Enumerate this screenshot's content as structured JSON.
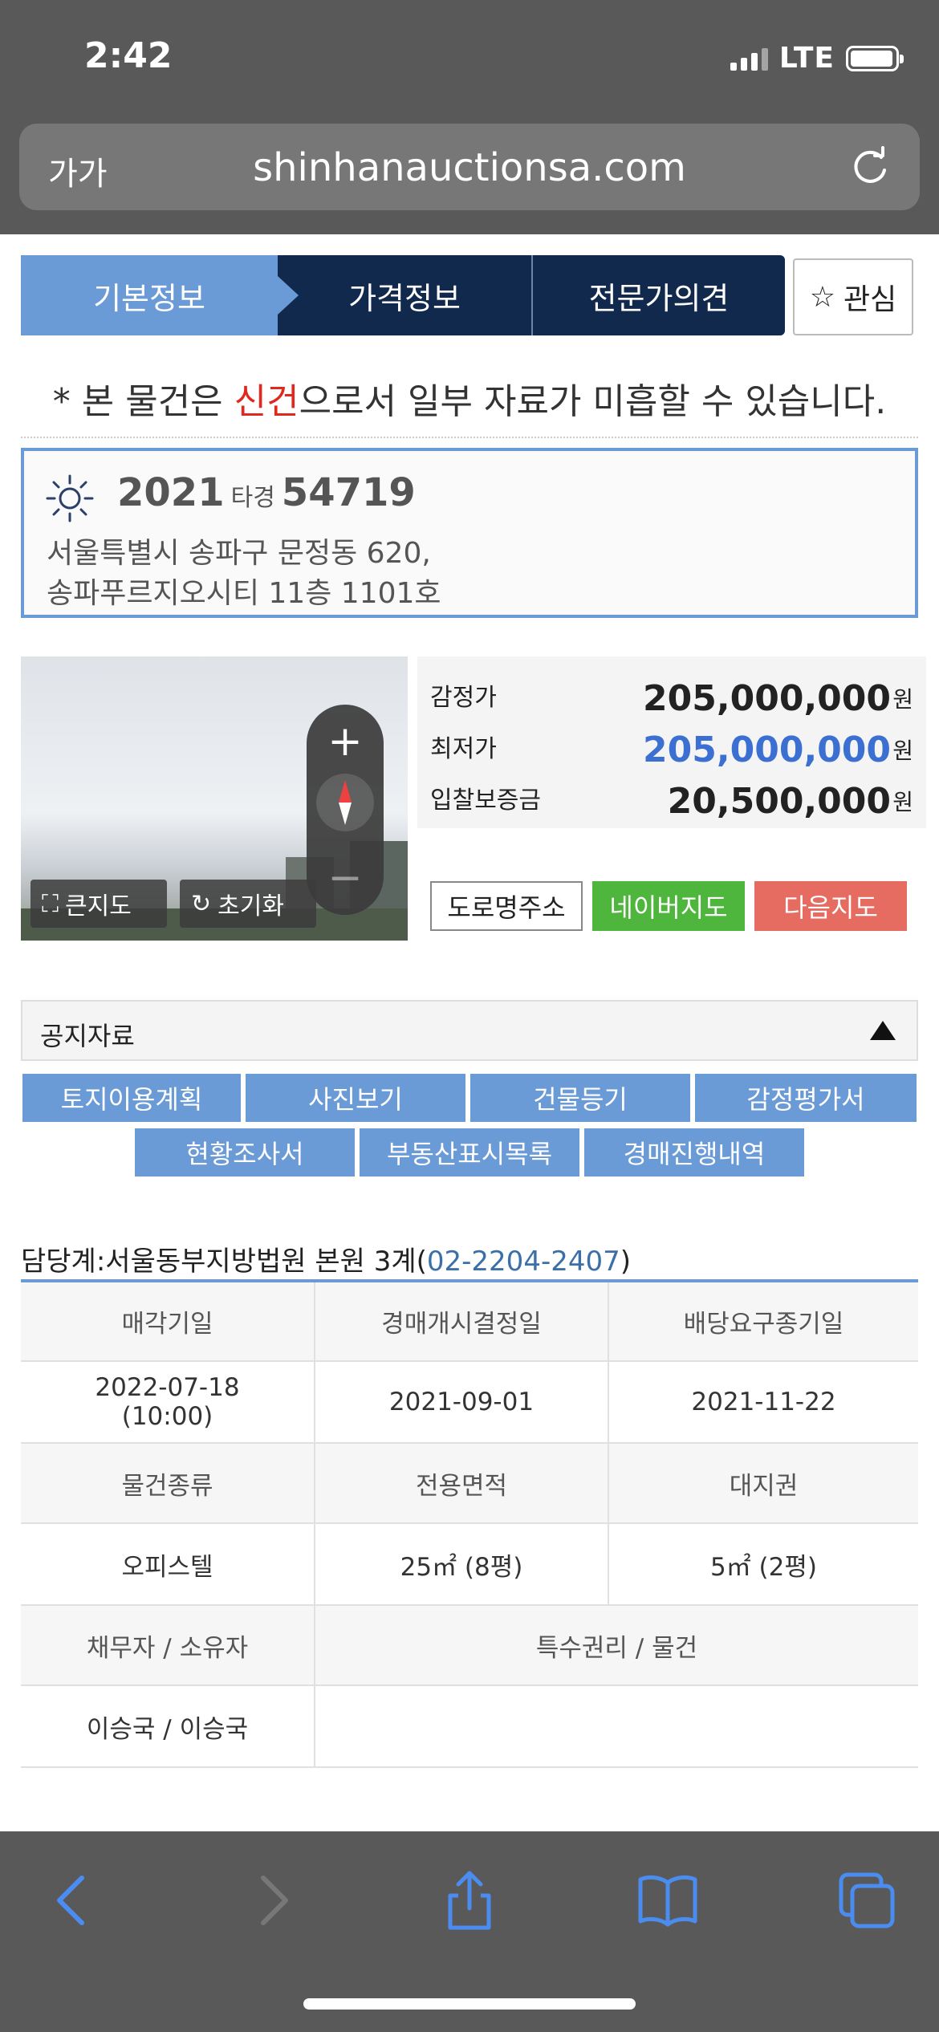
{
  "status_bar": {
    "time": "2:42",
    "network": "LTE"
  },
  "browser": {
    "aa_label": "가가",
    "url": "shinhanauctionsa.com"
  },
  "tabs": [
    {
      "label": "기본정보"
    },
    {
      "label": "가격정보"
    },
    {
      "label": "전문가의견"
    }
  ],
  "favorite": {
    "star": "☆",
    "label": "관심"
  },
  "notice": {
    "prefix": "* 본 물건은 ",
    "highlight": "신건",
    "suffix": "으로서 일부 자료가 미흡할 수 있습니다."
  },
  "case": {
    "year": "2021",
    "type": "타경",
    "number": "54719",
    "address_line1": "서울특별시 송파구 문정동 620,",
    "address_line2": "송파푸르지오시티 11층 1101호"
  },
  "map": {
    "plus": "+",
    "minus": "−",
    "big_map_label": "큰지도",
    "reset_label": "초기화"
  },
  "prices": [
    {
      "label": "감정가",
      "value": "205,000,000",
      "unit": "원",
      "color": "#222222"
    },
    {
      "label": "최저가",
      "value": "205,000,000",
      "unit": "원",
      "color": "#3b6fd1"
    },
    {
      "label": "입찰보증금",
      "value": "20,500,000",
      "unit": "원",
      "color": "#222222"
    }
  ],
  "map_links": {
    "road": "도로명주소",
    "naver": "네이버지도",
    "daum": "다음지도"
  },
  "documents": {
    "title": "공지자료",
    "row1": [
      "토지이용계획",
      "사진보기",
      "건물등기",
      "감정평가서"
    ],
    "row2": [
      "현황조사서",
      "부동산표시목록",
      "경매진행내역"
    ]
  },
  "court": {
    "prefix": "담당계:서울동부지방법원 본원 3계(",
    "phone": "02-2204-2407",
    "suffix": ")"
  },
  "info_table": {
    "headers1": [
      "매각기일",
      "경매개시결정일",
      "배당요구종기일"
    ],
    "values1": [
      "2022-07-18",
      "(10:00)",
      "2021-09-01",
      "2021-11-22"
    ],
    "headers2": [
      "물건종류",
      "전용면적",
      "대지권"
    ],
    "values2": [
      "오피스텔",
      "25㎡ (8평)",
      "5㎡ (2평)"
    ],
    "headers3": [
      "채무자 / 소유자",
      "특수권리 / 물건"
    ],
    "values3": [
      "이승국 / 이승국",
      ""
    ]
  },
  "colors": {
    "accent": "#6b9bd7",
    "navy": "#11294d",
    "toolbar_icon": "#4a8cf0"
  }
}
